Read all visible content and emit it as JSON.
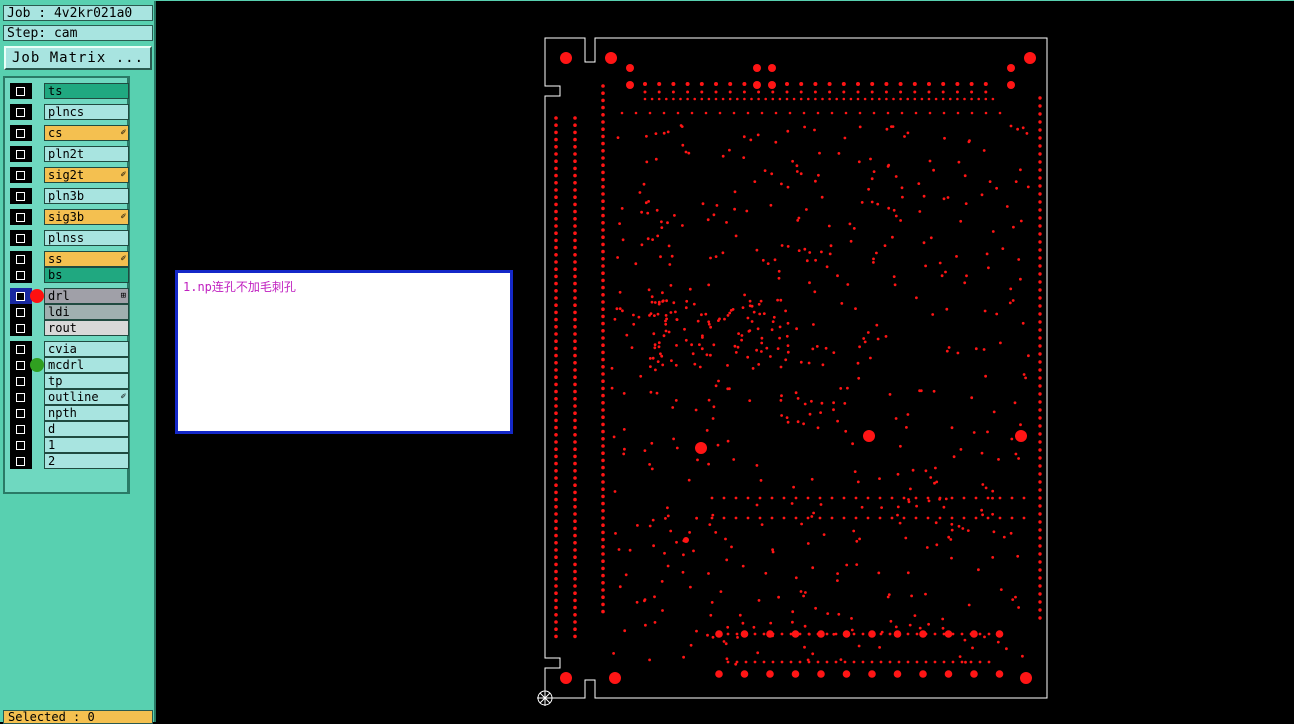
{
  "job": {
    "label": "Job : 4v2kr021a0"
  },
  "step": {
    "label": "Step: cam"
  },
  "buttons": {
    "job_matrix": "Job Matrix ..."
  },
  "status": {
    "selected": "Selected : 0"
  },
  "note": {
    "text": "1.np连孔不加毛刺孔"
  },
  "layers": [
    {
      "name": "ts",
      "color": "#20a880",
      "edit": false,
      "dot": null
    },
    {
      "name": "plncs",
      "color": "#a8e4e0",
      "edit": false,
      "dot": null
    },
    {
      "name": "cs",
      "color": "#f4c050",
      "edit": true,
      "dot": null
    },
    {
      "name": "pln2t",
      "color": "#a8e4e0",
      "edit": false,
      "dot": null
    },
    {
      "name": "sig2t",
      "color": "#f4c050",
      "edit": true,
      "dot": null
    },
    {
      "name": "pln3b",
      "color": "#a8e4e0",
      "edit": false,
      "dot": null
    },
    {
      "name": "sig3b",
      "color": "#f4c050",
      "edit": true,
      "dot": null
    },
    {
      "name": "plnss",
      "color": "#a8e4e0",
      "edit": false,
      "dot": null
    },
    {
      "name": "ss",
      "color": "#f4c050",
      "edit": true,
      "dot": null
    },
    {
      "name": "bs",
      "color": "#20a880",
      "edit": false,
      "dot": null
    },
    {
      "name": "drl",
      "color": "#a0a0a8",
      "edit": false,
      "dot": "#ff1010",
      "active": true
    },
    {
      "name": "ldi",
      "color": "#a0b0b0",
      "edit": false,
      "dot": null
    },
    {
      "name": "rout",
      "color": "#d8d8d8",
      "edit": false,
      "dot": null
    },
    {
      "name": "cvia",
      "color": "#a8e4e0",
      "edit": false,
      "dot": null
    },
    {
      "name": "mcdrl",
      "color": "#a8e4e0",
      "edit": false,
      "dot": "#30a020"
    },
    {
      "name": "tp",
      "color": "#a8e4e0",
      "edit": false,
      "dot": null
    },
    {
      "name": "outline",
      "color": "#a8e4e0",
      "edit": true,
      "dot": null
    },
    {
      "name": "npth",
      "color": "#a8e4e0",
      "edit": false,
      "dot": null
    },
    {
      "name": "d",
      "color": "#a8e4e0",
      "edit": false,
      "dot": null
    },
    {
      "name": "1",
      "color": "#a8e4e0",
      "edit": false,
      "dot": null
    },
    {
      "name": "2",
      "color": "#a8e4e0",
      "edit": false,
      "dot": null
    }
  ],
  "colors": {
    "drill": "#ff1515",
    "outline": "#ffffff",
    "panel": "#58d0b0",
    "note_border": "#1428c8",
    "note_text": "#c020c0"
  }
}
